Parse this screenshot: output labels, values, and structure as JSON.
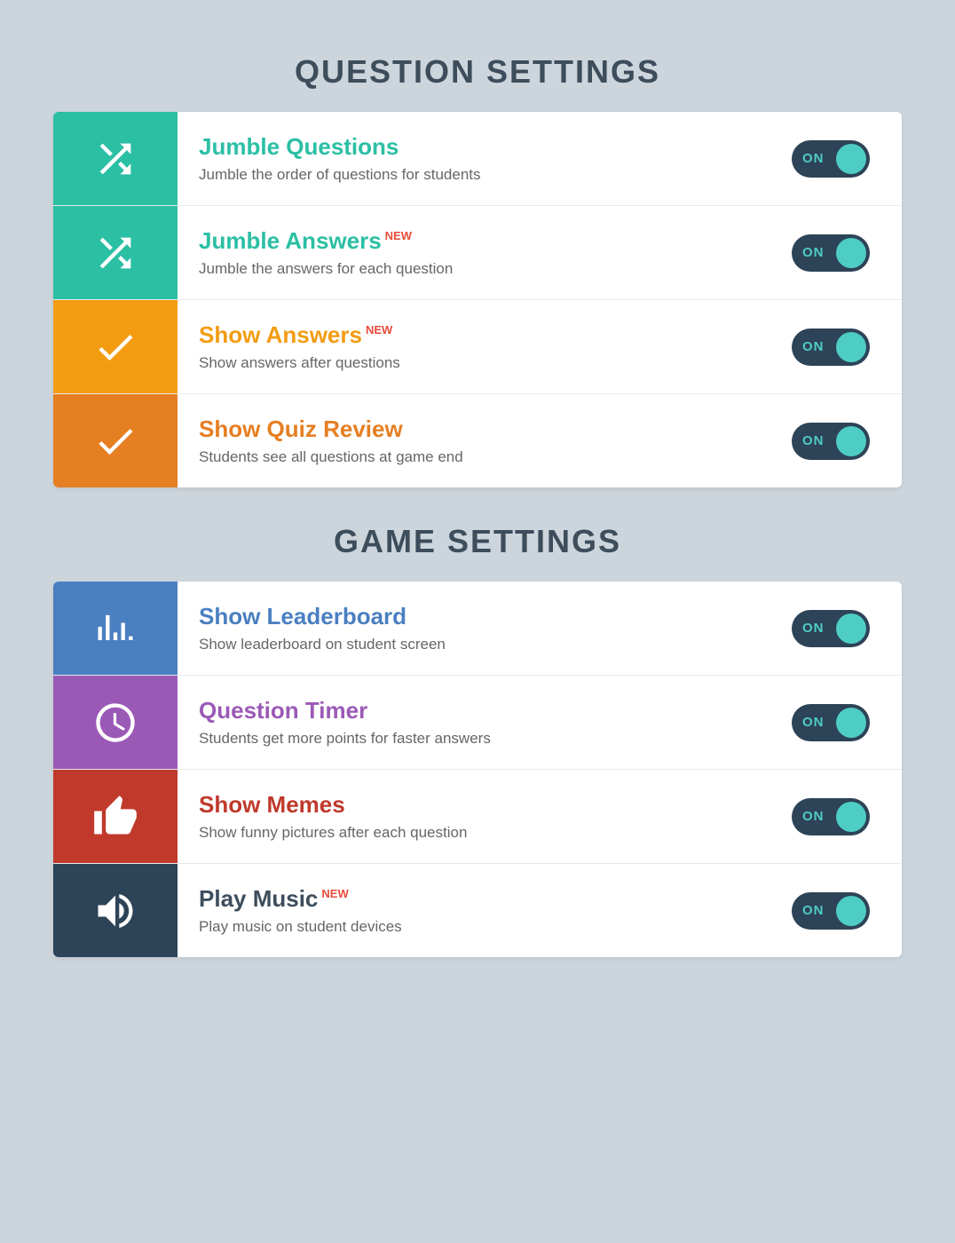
{
  "question_settings": {
    "title": "QUESTION SETTINGS",
    "items": [
      {
        "id": "jumble-questions",
        "icon_type": "shuffle",
        "icon_color": "teal",
        "title": "Jumble Questions",
        "title_color": "teal",
        "has_new": false,
        "description": "Jumble the order of questions for students",
        "toggle_state": "ON"
      },
      {
        "id": "jumble-answers",
        "icon_type": "shuffle",
        "icon_color": "teal2",
        "title": "Jumble Answers",
        "title_color": "teal",
        "has_new": true,
        "description": "Jumble the answers for each question",
        "toggle_state": "ON"
      },
      {
        "id": "show-answers",
        "icon_type": "check",
        "icon_color": "orange",
        "title": "Show Answers",
        "title_color": "orange",
        "has_new": true,
        "description": "Show answers after questions",
        "toggle_state": "ON"
      },
      {
        "id": "show-quiz-review",
        "icon_type": "check",
        "icon_color": "orange2",
        "title": "Show Quiz Review",
        "title_color": "orange2",
        "has_new": false,
        "description": "Students see all questions at game end",
        "toggle_state": "ON"
      }
    ]
  },
  "game_settings": {
    "title": "GAME SETTINGS",
    "items": [
      {
        "id": "show-leaderboard",
        "icon_type": "leaderboard",
        "icon_color": "blue",
        "title": "Show Leaderboard",
        "title_color": "blue",
        "has_new": false,
        "description": "Show leaderboard on student screen",
        "toggle_state": "ON"
      },
      {
        "id": "question-timer",
        "icon_type": "timer",
        "icon_color": "purple",
        "title": "Question Timer",
        "title_color": "purple",
        "has_new": false,
        "description": "Students get more points for faster answers",
        "toggle_state": "ON"
      },
      {
        "id": "show-memes",
        "icon_type": "thumbsup",
        "icon_color": "red",
        "title": "Show Memes",
        "title_color": "red",
        "has_new": false,
        "description": "Show funny pictures after each question",
        "toggle_state": "ON"
      },
      {
        "id": "play-music",
        "icon_type": "music",
        "icon_color": "dark",
        "title": "Play Music",
        "title_color": "dark",
        "has_new": true,
        "description": "Play music on student devices",
        "toggle_state": "ON"
      }
    ]
  },
  "labels": {
    "new": "NEW",
    "toggle_on": "ON"
  }
}
